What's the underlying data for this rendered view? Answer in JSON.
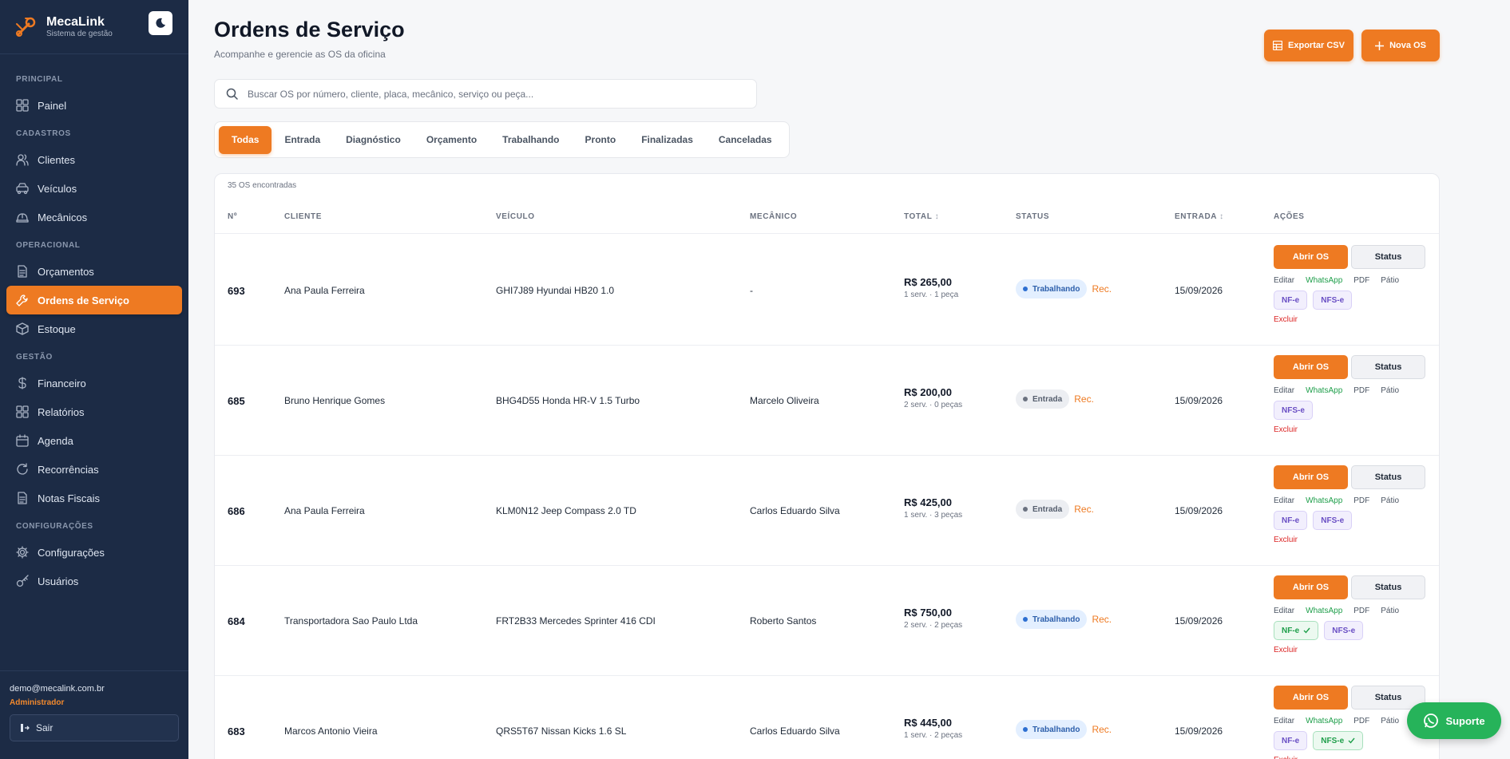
{
  "brand": {
    "name": "MecaLink",
    "subtitle": "Sistema de gestão"
  },
  "sidebar": {
    "sections": [
      {
        "title": "PRINCIPAL",
        "items": [
          {
            "label": "Painel",
            "icon": "grid-icon"
          }
        ]
      },
      {
        "title": "CADASTROS",
        "items": [
          {
            "label": "Clientes",
            "icon": "users-icon"
          },
          {
            "label": "Veículos",
            "icon": "car-icon"
          },
          {
            "label": "Mecânicos",
            "icon": "hard-hat-icon"
          }
        ]
      },
      {
        "title": "OPERACIONAL",
        "items": [
          {
            "label": "Orçamentos",
            "icon": "document-icon"
          },
          {
            "label": "Ordens de Serviço",
            "icon": "wrench-icon",
            "active": true
          },
          {
            "label": "Estoque",
            "icon": "box-icon"
          }
        ]
      },
      {
        "title": "GESTÃO",
        "items": [
          {
            "label": "Financeiro",
            "icon": "dollar-icon"
          },
          {
            "label": "Relatórios",
            "icon": "grid-icon"
          },
          {
            "label": "Agenda",
            "icon": "calendar-icon"
          },
          {
            "label": "Recorrências",
            "icon": "refresh-icon"
          },
          {
            "label": "Notas Fiscais",
            "icon": "document-icon"
          }
        ]
      },
      {
        "title": "CONFIGURAÇÕES",
        "items": [
          {
            "label": "Configurações",
            "icon": "gear-icon"
          },
          {
            "label": "Usuários",
            "icon": "key-icon"
          }
        ]
      }
    ],
    "user": {
      "email": "demo@mecalink.com.br",
      "role": "Administrador"
    },
    "logout_label": "Sair"
  },
  "header": {
    "title": "Ordens de Serviço",
    "subtitle": "Acompanhe e gerencie as OS da oficina",
    "export_label": "Exportar CSV",
    "new_label": "Nova OS"
  },
  "search": {
    "placeholder": "Buscar OS por número, cliente, placa, mecânico, serviço ou peça..."
  },
  "tabs": [
    "Todas",
    "Entrada",
    "Diagnóstico",
    "Orçamento",
    "Trabalhando",
    "Pronto",
    "Finalizadas",
    "Canceladas"
  ],
  "active_tab": "Todas",
  "table": {
    "count_text": "35 OS encontradas",
    "columns": [
      "Nº",
      "CLIENTE",
      "VEÍCULO",
      "MECÂNICO",
      "TOTAL",
      "STATUS",
      "ENTRADA",
      "AÇÕES"
    ],
    "rows": [
      {
        "num": "693",
        "client": "Ana Paula Ferreira",
        "vehicle": "GHI7J89 Hyundai HB20 1.0",
        "mechanic": "-",
        "total": "R$ 265,00",
        "detail": "1 serv. · 1 peça",
        "status": "Trabalhando",
        "status_color": "blue",
        "rec": "Rec.",
        "date": "15/09/2026",
        "chips": [
          {
            "label": "NF-e",
            "type": "purple"
          },
          {
            "label": "NFS-e",
            "type": "purple"
          }
        ]
      },
      {
        "num": "685",
        "client": "Bruno Henrique Gomes",
        "vehicle": "BHG4D55 Honda HR-V 1.5 Turbo",
        "mechanic": "Marcelo Oliveira",
        "total": "R$ 200,00",
        "detail": "2 serv. · 0 peças",
        "status": "Entrada",
        "status_color": "gray",
        "rec": "Rec.",
        "date": "15/09/2026",
        "chips": [
          {
            "label": "NFS-e",
            "type": "purple"
          }
        ]
      },
      {
        "num": "686",
        "client": "Ana Paula Ferreira",
        "vehicle": "KLM0N12 Jeep Compass 2.0 TD",
        "mechanic": "Carlos Eduardo Silva",
        "total": "R$ 425,00",
        "detail": "1 serv. · 3 peças",
        "status": "Entrada",
        "status_color": "gray",
        "rec": "Rec.",
        "date": "15/09/2026",
        "chips": [
          {
            "label": "NF-e",
            "type": "purple"
          },
          {
            "label": "NFS-e",
            "type": "purple"
          }
        ]
      },
      {
        "num": "684",
        "client": "Transportadora Sao Paulo Ltda",
        "vehicle": "FRT2B33 Mercedes Sprinter 416 CDI",
        "mechanic": "Roberto Santos",
        "total": "R$ 750,00",
        "detail": "2 serv. · 2 peças",
        "status": "Trabalhando",
        "status_color": "blue",
        "rec": "Rec.",
        "date": "15/09/2026",
        "chips": [
          {
            "label": "NF-e",
            "type": "green"
          },
          {
            "label": "NFS-e",
            "type": "purple"
          }
        ]
      },
      {
        "num": "683",
        "client": "Marcos Antonio Vieira",
        "vehicle": "QRS5T67 Nissan Kicks 1.6 SL",
        "mechanic": "Carlos Eduardo Silva",
        "total": "R$ 445,00",
        "detail": "1 serv. · 2 peças",
        "status": "Trabalhando",
        "status_color": "blue",
        "rec": "Rec.",
        "date": "15/09/2026",
        "chips": [
          {
            "label": "NF-e",
            "type": "purple"
          },
          {
            "label": "NFS-e",
            "type": "green"
          }
        ]
      }
    ],
    "actions": {
      "open": "Abrir OS",
      "status": "Status",
      "edit": "Editar",
      "whatsapp": "WhatsApp",
      "pdf": "PDF",
      "yard": "Pátio",
      "delete": "Excluir"
    }
  },
  "support_label": "Suporte",
  "colors": {
    "accent": "#ee7a22",
    "sidebar": "#1c2b45",
    "whatsapp": "#26b35a"
  }
}
